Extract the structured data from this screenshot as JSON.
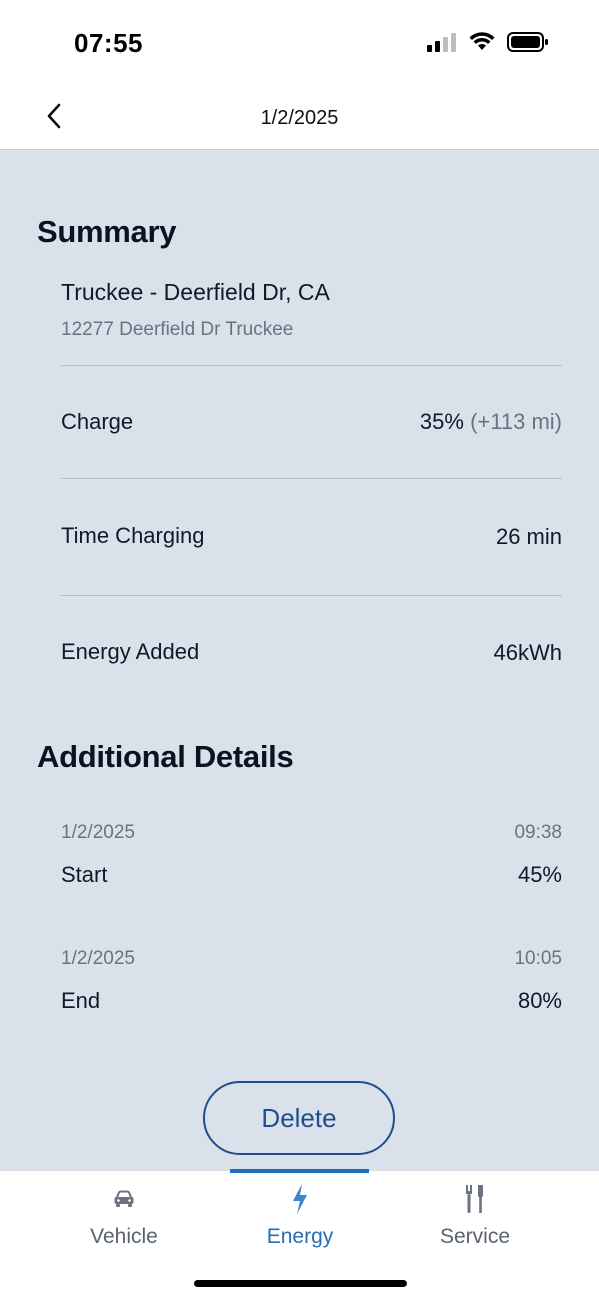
{
  "status_bar": {
    "time": "07:55",
    "icons": [
      "cellular-signal-icon",
      "wifi-icon",
      "battery-icon"
    ]
  },
  "header": {
    "title": "1/2/2025",
    "back_icon": "chevron-left-icon"
  },
  "summary": {
    "title": "Summary",
    "location_name": "Truckee - Deerfield Dr, CA",
    "location_address": "12277 Deerfield Dr Truckee",
    "rows": [
      {
        "label": "Charge",
        "value": "35%",
        "extra": "(+113 mi)"
      },
      {
        "label": "Time Charging",
        "value": "26 min"
      },
      {
        "label": "Energy Added",
        "value": "46kWh"
      }
    ]
  },
  "details": {
    "title": "Additional Details",
    "events": [
      {
        "date": "1/2/2025",
        "time": "09:38",
        "label": "Start",
        "value": "45%"
      },
      {
        "date": "1/2/2025",
        "time": "10:05",
        "label": "End",
        "value": "80%"
      }
    ]
  },
  "delete_label": "Delete",
  "tabs": [
    {
      "label": "Vehicle",
      "icon": "car-icon"
    },
    {
      "label": "Energy",
      "icon": "lightning-bolt-icon",
      "active": true
    },
    {
      "label": "Service",
      "icon": "tools-icon"
    }
  ],
  "colors": {
    "accent": "#2a6bb3",
    "content_background": "#dbe1eb",
    "delete_border": "#1f4f8a"
  }
}
